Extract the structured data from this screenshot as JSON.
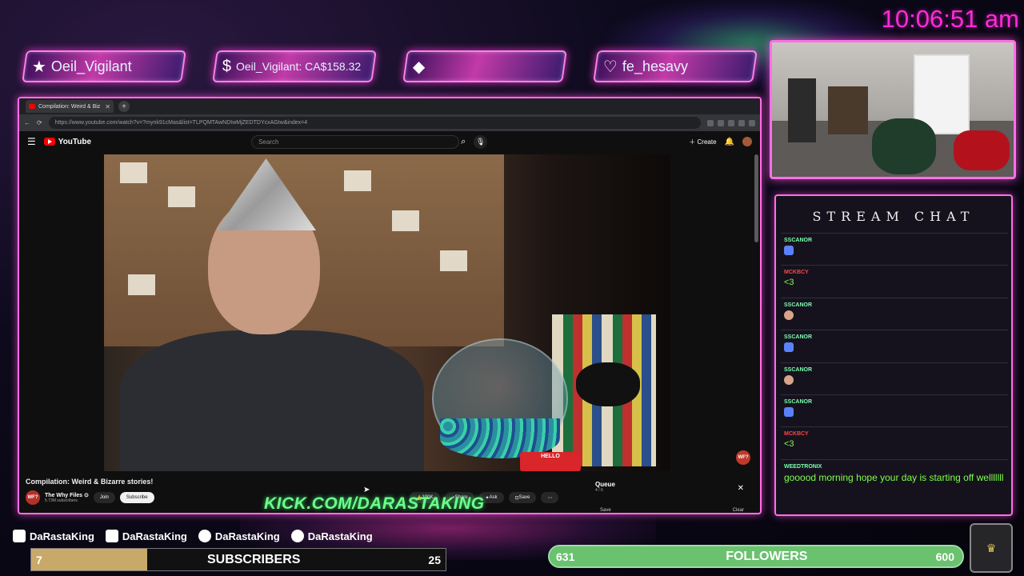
{
  "clock": "10:06:51 am",
  "alerts": [
    {
      "icon": "star-icon",
      "glyph": "★",
      "text": "Oeil_Vigilant"
    },
    {
      "icon": "dollar-icon",
      "glyph": "$",
      "text": "Oeil_Vigilant: CA$158.32"
    },
    {
      "icon": "diamond-icon",
      "glyph": "◆",
      "text": ""
    },
    {
      "icon": "heart-icon",
      "glyph": "♡",
      "text": "fe_hesavy"
    }
  ],
  "browser": {
    "tab_title": "Compilation: Weird & Biz",
    "url": "https://www.youtube.com/watch?v=?mynk91cMas&list=TLPQMTAwNDIwMjZEDTDYcxAGtw&index=4"
  },
  "youtube": {
    "logo_text": "YouTube",
    "search_placeholder": "Search",
    "create_label": "Create",
    "video_title": "Compilation: Weird & Bizarre stories!",
    "channel_name": "The Why Files ⊙",
    "channel_subs": "5.73M subscribers",
    "join_label": "Join",
    "subscribe_label": "Subscribe",
    "like_count": "100K",
    "share_label": "Share",
    "ask_label": "Ask",
    "save_label": "Save",
    "channel_badge": "WF?",
    "hello_tag": "HELLO",
    "queue": {
      "title": "Queue",
      "count": "4 / 6",
      "save": "Save",
      "clear": "Clear"
    }
  },
  "kick_url": "KICK.COM/DARASTAKING",
  "chat": {
    "title": "STREAM CHAT",
    "messages": [
      {
        "user": "SSCANOR",
        "text": "",
        "emote": "blue",
        "user_color": "green"
      },
      {
        "user": "MCKBCY",
        "text": "<3",
        "emote": "",
        "user_color": "red"
      },
      {
        "user": "SSCANOR",
        "text": "",
        "emote": "face",
        "user_color": "green"
      },
      {
        "user": "SSCANOR",
        "text": "",
        "emote": "blue",
        "user_color": "green"
      },
      {
        "user": "SSCANOR",
        "text": "",
        "emote": "face",
        "user_color": "green"
      },
      {
        "user": "SSCANOR",
        "text": "",
        "emote": "blue",
        "user_color": "green"
      },
      {
        "user": "MCKBCY",
        "text": "<3",
        "emote": "",
        "user_color": "red"
      },
      {
        "user": "WEEDTRONIX",
        "text": "gooood morning hope your day is starting off welllllll",
        "emote": "",
        "user_color": "green"
      }
    ]
  },
  "socials": [
    {
      "icon": "twitch-icon",
      "handle": "DaRastaKing"
    },
    {
      "icon": "youtube-icon",
      "handle": "DaRastaKing"
    },
    {
      "icon": "instagram-icon",
      "handle": "DaRastaKing"
    },
    {
      "icon": "twitter-icon",
      "handle": "DaRastaKing"
    }
  ],
  "subscribers": {
    "current": "7",
    "label": "SUBSCRIBERS",
    "goal": "25",
    "progress": 0.28
  },
  "followers": {
    "current": "631",
    "label": "FOLLOWERS",
    "goal": "600",
    "progress": 1.0
  },
  "colors": {
    "neon_pink": "#ff6fe6",
    "clock": "#ff2bd8",
    "kick_green": "#6dff8a",
    "chat_text": "#7dff4a",
    "follower_bar": "#3c9a4e",
    "sub_fill": "#c8a96a"
  }
}
